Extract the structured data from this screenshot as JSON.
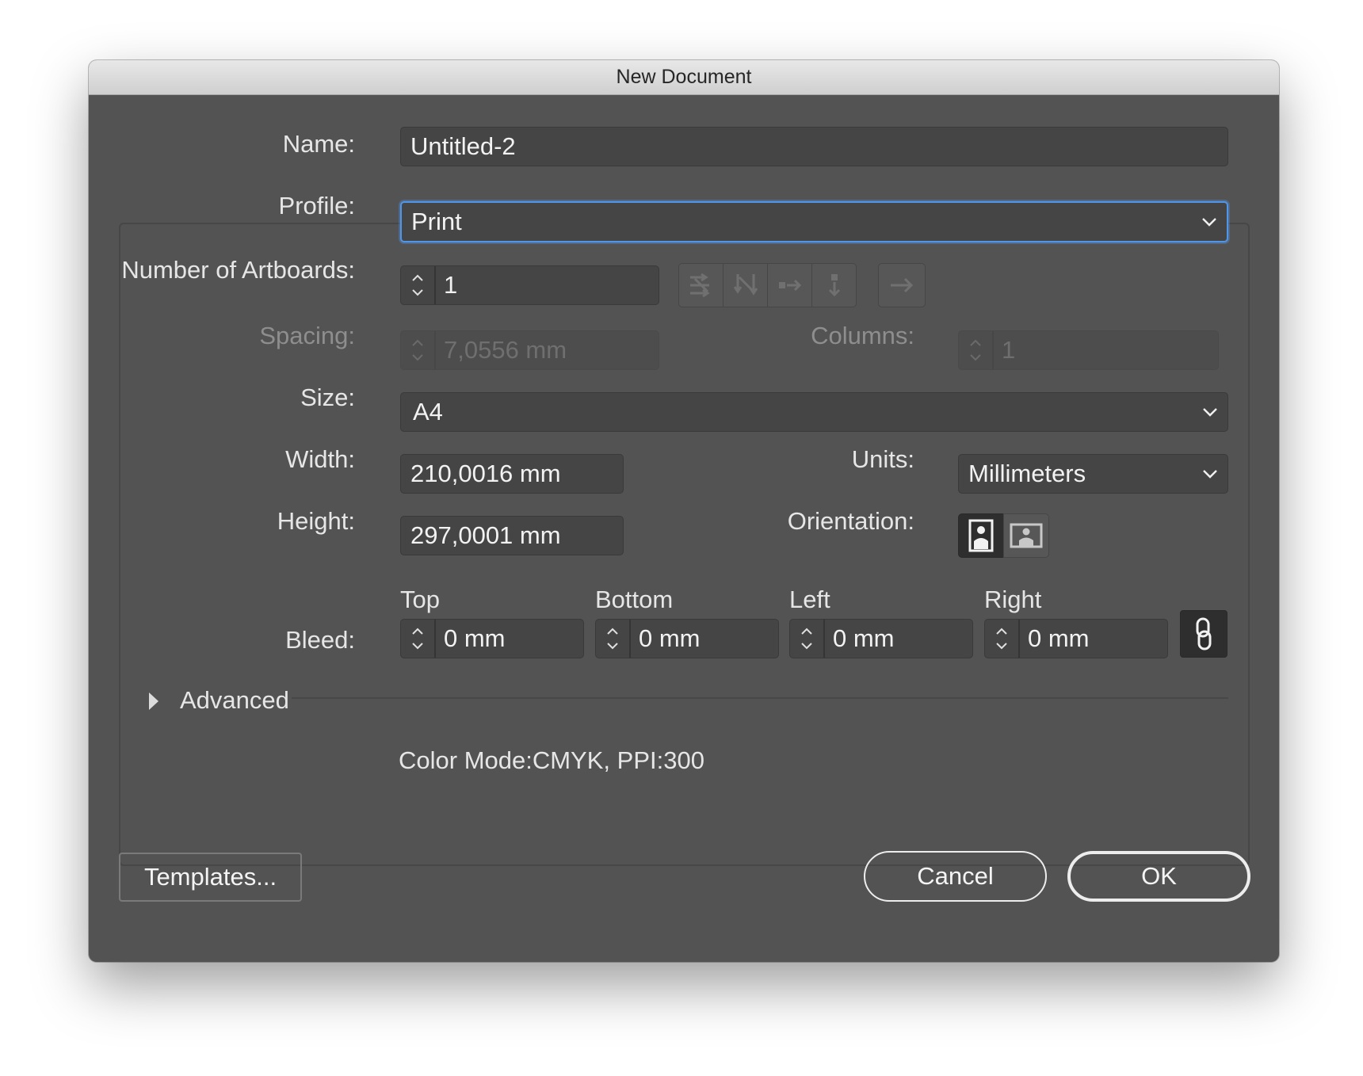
{
  "window": {
    "title": "New Document"
  },
  "form": {
    "name": {
      "label": "Name:",
      "value": "Untitled-2"
    },
    "profile": {
      "label": "Profile:",
      "value": "Print"
    },
    "artboards": {
      "label": "Number of Artboards:",
      "value": "1"
    },
    "spacing": {
      "label": "Spacing:",
      "value": "7,0556 mm"
    },
    "columns": {
      "label": "Columns:",
      "value": "1"
    },
    "size": {
      "label": "Size:",
      "value": "A4"
    },
    "width": {
      "label": "Width:",
      "value": "210,0016 mm"
    },
    "units": {
      "label": "Units:",
      "value": "Millimeters"
    },
    "height": {
      "label": "Height:",
      "value": "297,0001 mm"
    },
    "orientation": {
      "label": "Orientation:",
      "selected": "portrait"
    },
    "bleed": {
      "label": "Bleed:",
      "top": {
        "label": "Top",
        "value": "0 mm"
      },
      "bottom": {
        "label": "Bottom",
        "value": "0 mm"
      },
      "left": {
        "label": "Left",
        "value": "0 mm"
      },
      "right": {
        "label": "Right",
        "value": "0 mm"
      }
    },
    "advanced": {
      "label": "Advanced"
    },
    "info": "Color Mode:CMYK, PPI:300"
  },
  "buttons": {
    "templates": "Templates...",
    "cancel": "Cancel",
    "ok": "OK"
  },
  "icons": {
    "artboard_layout": [
      "grid-by-row-icon",
      "grid-by-column-icon",
      "arrange-by-row-icon",
      "arrange-by-column-icon"
    ],
    "layout_direction": "arrow-right-icon",
    "orientation": [
      "portrait-icon",
      "landscape-icon"
    ],
    "link": "chain-link-icon"
  },
  "colors": {
    "dialog_bg": "#535353",
    "field_bg": "#454545",
    "focus_ring": "#4f96e8",
    "text": "#e6e6e6"
  }
}
